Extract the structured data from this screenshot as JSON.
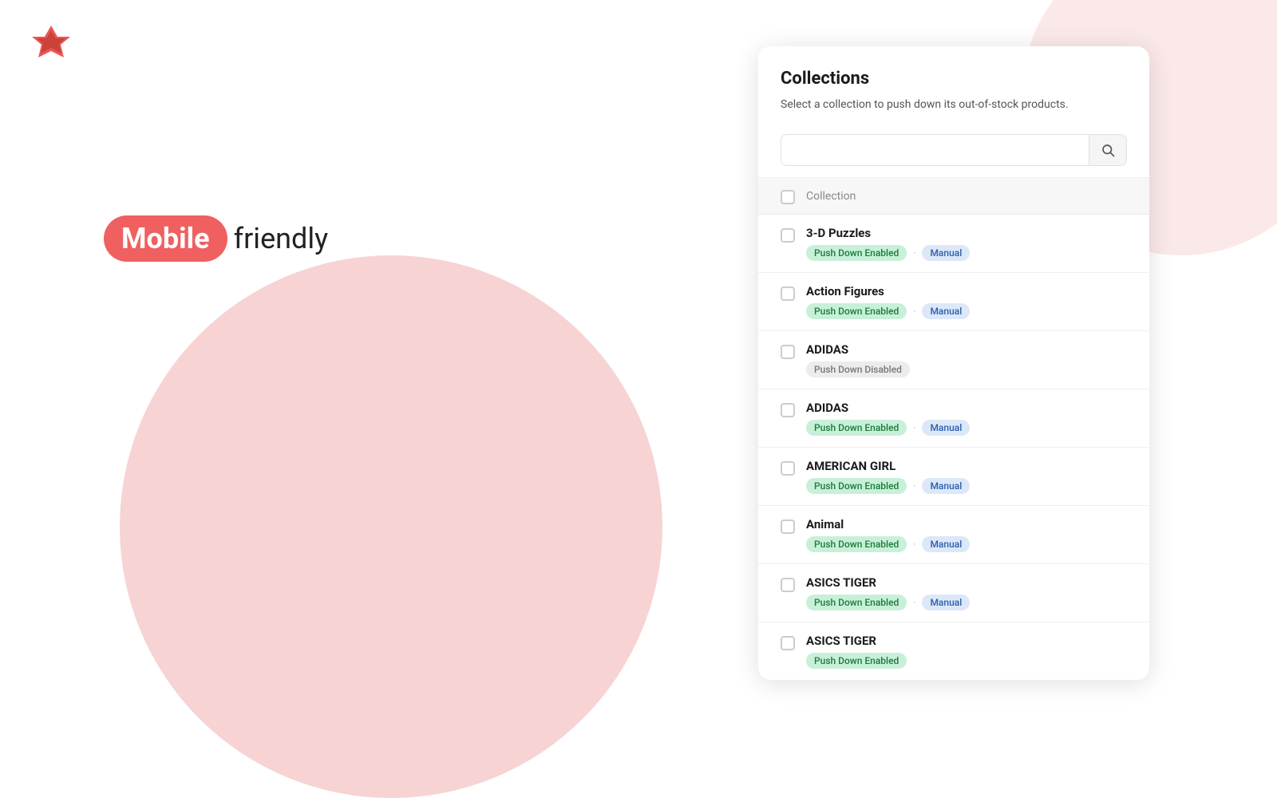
{
  "logo": {
    "alt": "App Logo"
  },
  "hero": {
    "mobile_label": "Mobile",
    "friendly_label": "friendly"
  },
  "panel": {
    "title": "Collections",
    "subtitle": "Select a collection to push down its out-of-stock products.",
    "search_placeholder": "",
    "search_button_icon": "🔍",
    "header_col": "Collection",
    "items": [
      {
        "name": "3-D Puzzles",
        "badges": [
          {
            "label": "Push Down Enabled",
            "type": "enabled"
          },
          {
            "label": "Manual",
            "type": "manual"
          }
        ]
      },
      {
        "name": "Action Figures",
        "badges": [
          {
            "label": "Push Down Enabled",
            "type": "enabled"
          },
          {
            "label": "Manual",
            "type": "manual"
          }
        ]
      },
      {
        "name": "ADIDAS",
        "badges": [
          {
            "label": "Push Down Disabled",
            "type": "disabled"
          }
        ]
      },
      {
        "name": "ADIDAS",
        "badges": [
          {
            "label": "Push Down Enabled",
            "type": "enabled"
          },
          {
            "label": "Manual",
            "type": "manual"
          }
        ]
      },
      {
        "name": "AMERICAN GIRL",
        "badges": [
          {
            "label": "Push Down Enabled",
            "type": "enabled"
          },
          {
            "label": "Manual",
            "type": "manual"
          }
        ]
      },
      {
        "name": "Animal",
        "badges": [
          {
            "label": "Push Down Enabled",
            "type": "enabled"
          },
          {
            "label": "Manual",
            "type": "manual"
          }
        ]
      },
      {
        "name": "ASICS TIGER",
        "badges": [
          {
            "label": "Push Down Enabled",
            "type": "enabled"
          },
          {
            "label": "Manual",
            "type": "manual"
          }
        ]
      },
      {
        "name": "ASICS TIGER",
        "badges": [
          {
            "label": "Push Down Enabled",
            "type": "enabled"
          }
        ]
      }
    ]
  }
}
